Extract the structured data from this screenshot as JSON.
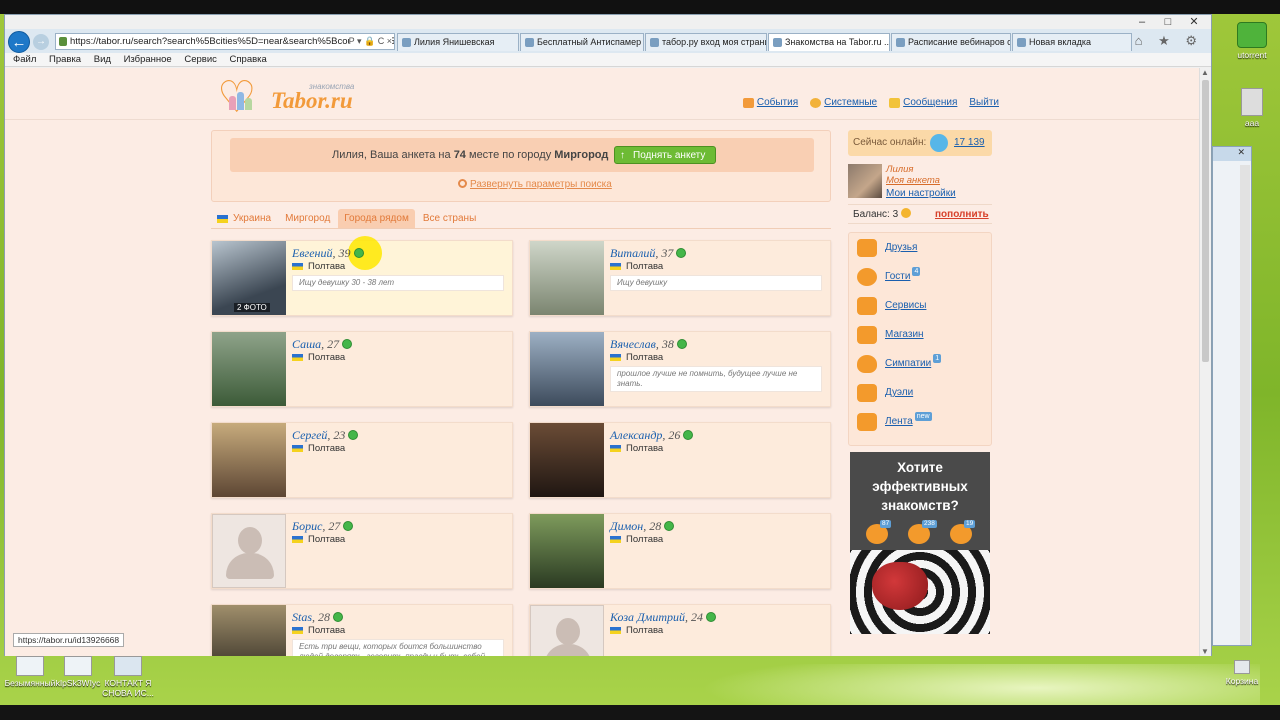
{
  "browser": {
    "window_controls": [
      "–",
      "□",
      "✕"
    ],
    "back_icon": "back-arrow-icon",
    "address": "https://tabor.ru/search?search%5Bcities%5D=near&search%5Bcountry_id%5D",
    "address_icons": "P ▾ 🔒 C ×",
    "tabs": [
      "Лилия Янишевская",
      "Бесплатный Антиспамер д...",
      "табор.ру вход моя страниц...",
      "Знакомства на Tabor.ru ...",
      "Расписание вебинаров с 2 ...",
      "Новая вкладка"
    ],
    "right_icons": "⌂ ★ ⚙",
    "menu": [
      "Файл",
      "Правка",
      "Вид",
      "Избранное",
      "Сервис",
      "Справка"
    ],
    "status_url": "https://tabor.ru/id13926668"
  },
  "site": {
    "logo_text": "Tabor.ru",
    "logo_sub": "знакомства",
    "top_links": [
      {
        "label": "События",
        "color": "#f29a3a"
      },
      {
        "label": "Системные",
        "color": "#f2b23a"
      },
      {
        "label": "Сообщения",
        "color": "#f2c33a"
      },
      {
        "label": "Выйти",
        "color": ""
      }
    ]
  },
  "notice": {
    "prefix": "Лилия, Ваша анкета на",
    "rank": "74",
    "middle": "месте по городу",
    "city": "Миргород",
    "raise_button": "Поднять анкету",
    "expand_link": "Развернуть параметры поиска"
  },
  "location_tabs": [
    {
      "label": "Украина",
      "active": false
    },
    {
      "label": "Миргород",
      "active": false
    },
    {
      "label": "Города рядом",
      "active": true
    },
    {
      "label": "Все страны",
      "active": false
    }
  ],
  "profiles": [
    {
      "name": "Евгений",
      "age": ", 39",
      "city": "Полтава",
      "status": "Ищу девушку 30 - 38 лет",
      "badge": "2 ФОТО",
      "photo": "#5b6b78",
      "has_photo": true
    },
    {
      "name": "Виталий",
      "age": ", 37",
      "city": "Полтава",
      "status": "Ищу девушку",
      "badge": "",
      "photo": "#b9c2b0",
      "has_photo": true
    },
    {
      "name": "Саша",
      "age": ", 27",
      "city": "Полтава",
      "status": "",
      "badge": "",
      "photo": "#4e6b4a",
      "has_photo": true
    },
    {
      "name": "Вячеслав",
      "age": ", 38",
      "city": "Полтава",
      "status": "прошлое лучше не помнить, будущее лучше не знать.",
      "badge": "",
      "photo": "#6c7c8c",
      "has_photo": true
    },
    {
      "name": "Сергей",
      "age": ", 23",
      "city": "Полтава",
      "status": "",
      "badge": "",
      "photo": "#9a8060",
      "has_photo": true
    },
    {
      "name": "Александр",
      "age": ", 26",
      "city": "Полтава",
      "status": "",
      "badge": "",
      "photo": "#3d2c22",
      "has_photo": true
    },
    {
      "name": "Борис",
      "age": ", 27",
      "city": "Полтава",
      "status": "",
      "badge": "",
      "photo": "",
      "has_photo": false
    },
    {
      "name": "Димон",
      "age": ", 28",
      "city": "Полтава",
      "status": "",
      "badge": "",
      "photo": "#4c6a3a",
      "has_photo": true
    },
    {
      "name": "Stas",
      "age": ", 28",
      "city": "Полтава",
      "status": "Есть три вещи, которых боится большинство людей доверять, говорить правду и быть собой.",
      "badge": "",
      "photo": "#5a5040",
      "has_photo": true
    },
    {
      "name": "Коза Дмитрий",
      "age": ", 24",
      "city": "Полтава",
      "status": "",
      "badge": "",
      "photo": "",
      "has_photo": false
    }
  ],
  "sidebar": {
    "online_label": "Сейчас онлайн:",
    "online_count": "17 139",
    "me_name": "Лилия",
    "my_profile": "Моя анкета",
    "my_settings": "Мои настройки",
    "balance_label": "Баланс: 3",
    "topup": "пополнить",
    "nav": [
      {
        "label": "Друзья",
        "badge": "",
        "icon": "friends-icon"
      },
      {
        "label": "Гости",
        "badge": "4",
        "icon": "guests-icon"
      },
      {
        "label": "Сервисы",
        "badge": "",
        "icon": "services-icon"
      },
      {
        "label": "Магазин",
        "badge": "",
        "icon": "shop-icon"
      },
      {
        "label": "Симпатии",
        "badge": "1",
        "icon": "heart-icon"
      },
      {
        "label": "Дуэли",
        "badge": "",
        "icon": "duel-icon"
      },
      {
        "label": "Лента",
        "badge": "new",
        "icon": "feed-icon"
      }
    ],
    "ad_title": "Хотите эффективных знакомств?",
    "ad_badges": [
      "87",
      "238",
      "19"
    ]
  },
  "desktop": {
    "icons": [
      "Безымянный",
      "kIpSk3WIyc",
      "КОНТАКТ Я СНОВА ИС...",
      "utorrent",
      "ааа",
      "Корзина"
    ]
  }
}
